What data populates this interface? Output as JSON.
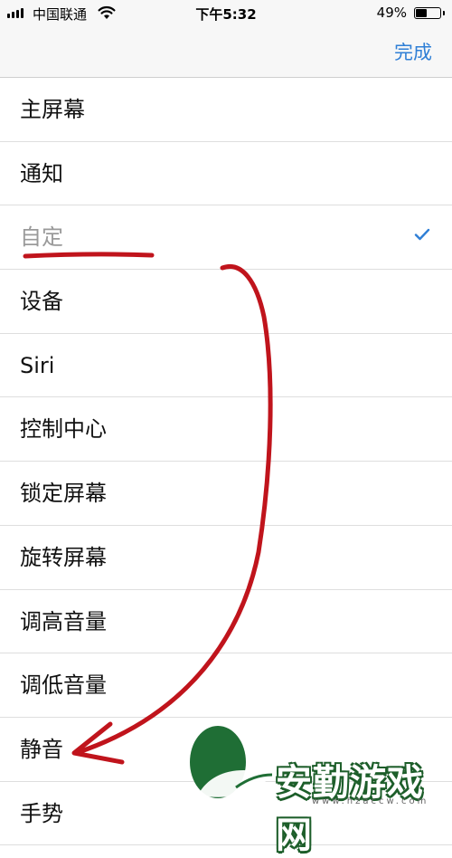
{
  "status_bar": {
    "carrier": "中国联通",
    "time": "下午5:32",
    "battery_text": "49%",
    "battery_level": 0.49,
    "icons": [
      "signal-icon",
      "wifi-icon",
      "battery-icon"
    ]
  },
  "nav": {
    "done_label": "完成",
    "accent_color": "#2f7fd6"
  },
  "list": {
    "items": [
      {
        "label": "主屏幕",
        "selected": false
      },
      {
        "label": "通知",
        "selected": false
      },
      {
        "label": "自定",
        "selected": true
      },
      {
        "label": "设备",
        "selected": false
      },
      {
        "label": "Siri",
        "selected": false
      },
      {
        "label": "控制中心",
        "selected": false
      },
      {
        "label": "锁定屏幕",
        "selected": false
      },
      {
        "label": "旋转屏幕",
        "selected": false
      },
      {
        "label": "调高音量",
        "selected": false
      },
      {
        "label": "调低音量",
        "selected": false
      },
      {
        "label": "静音",
        "selected": false
      },
      {
        "label": "手势",
        "selected": false
      }
    ],
    "check_icon": "checkmark-icon"
  },
  "annotation": {
    "color": "#c0141c",
    "icons": [
      "underline-mark",
      "curved-arrow-icon"
    ]
  },
  "watermark": {
    "brand": "安勤游戏网",
    "url": "www.hzaccw.com",
    "logo_icon": "leaf-logo-icon"
  }
}
